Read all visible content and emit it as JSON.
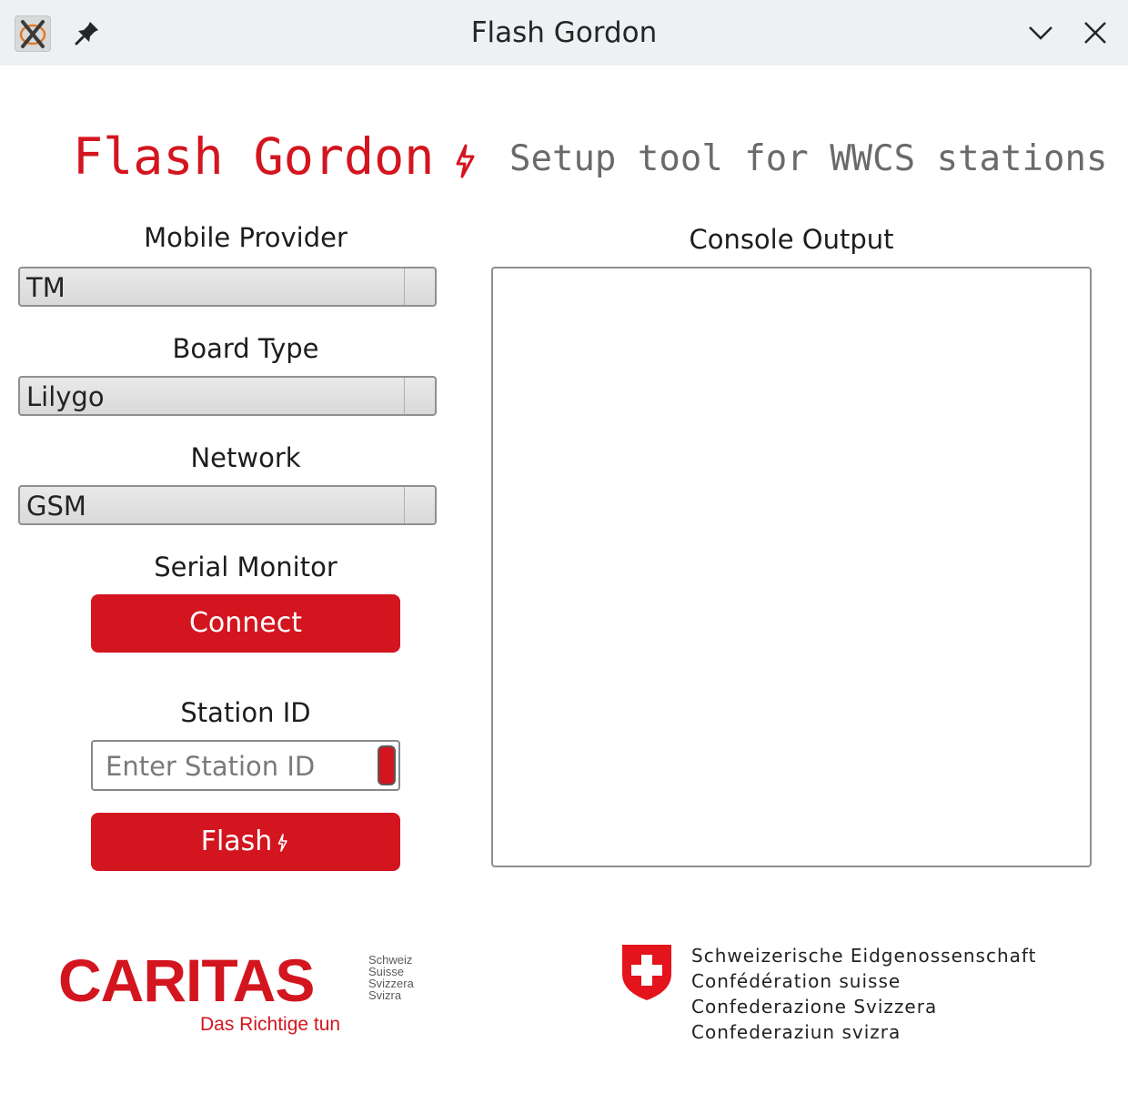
{
  "window": {
    "title": "Flash Gordon",
    "icons": [
      "app-icon",
      "pin-icon",
      "minimize-icon",
      "close-icon"
    ]
  },
  "header": {
    "title": "Flash Gordon",
    "subtitle": "Setup tool for WWCS stations",
    "bolt_icon": "lightning-bolt-icon"
  },
  "form": {
    "mobile_provider": {
      "label": "Mobile Provider",
      "value": "TM"
    },
    "board_type": {
      "label": "Board Type",
      "value": "Lilygo"
    },
    "network": {
      "label": "Network",
      "value": "GSM"
    },
    "serial_monitor": {
      "label": "Serial Monitor",
      "button": "Connect"
    },
    "station_id": {
      "label": "Station ID",
      "placeholder": "Enter Station ID",
      "value": ""
    },
    "flash_button": "Flash"
  },
  "console": {
    "label": "Console Output",
    "content": ""
  },
  "footer": {
    "caritas": {
      "name": "CARITAS",
      "languages": [
        "Schweiz",
        "Suisse",
        "Svizzera",
        "Svizra"
      ],
      "slogan": "Das Richtige tun"
    },
    "confederation": {
      "lines": [
        "Schweizerische Eidgenossenschaft",
        "Confédération suisse",
        "Confederazione Svizzera",
        "Confederaziun svizra"
      ]
    }
  },
  "colors": {
    "accent": "#d3151f",
    "titlebar": "#eff0f1",
    "subtitle": "#6a6a6a"
  }
}
